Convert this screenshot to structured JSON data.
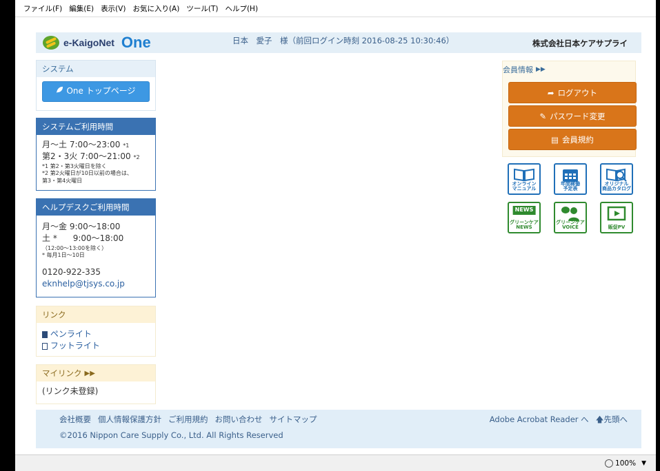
{
  "menubar": {
    "items": [
      "ファイル(F)",
      "編集(E)",
      "表示(V)",
      "お気に入り(A)",
      "ツール(T)",
      "ヘルプ(H)"
    ]
  },
  "header": {
    "logo_text": "e-KaigoNet",
    "logo_one": "One",
    "user_info": "日本　愛子　様（前回ログイン時刻 2016-08-25 10:30:46）",
    "company": "株式会社日本ケアサプライ"
  },
  "system_panel": {
    "title": "システム",
    "button_label": "One トップページ"
  },
  "usage_panel": {
    "title": "システムご利用時間",
    "line1": "月～土  7:00～23:00",
    "line1_note": "*1",
    "line2": "第2・3火 7:00～21:00",
    "line2_note": "*2",
    "note1": "*1 第2・第3火曜日を除く",
    "note2": "*2 第2火曜日が10日以前の場合は、",
    "note3": "第3・第4火曜日"
  },
  "helpdesk_panel": {
    "title": "ヘルプデスクご利用時間",
    "line1": "月～金  9:00～18:00",
    "line2": "土 *      9:00～18:00",
    "note1": "（12:00～13:00を除く）",
    "note2": "* 毎月1日～10日",
    "phone": "0120-922-335",
    "email": "eknhelp@tjsys.co.jp"
  },
  "link_panel": {
    "title": "リンク",
    "items": [
      "ペンライト",
      "フットライト"
    ]
  },
  "mylink_panel": {
    "title": "マイリンク",
    "empty": "(リンク未登録)"
  },
  "member_panel": {
    "title": "会員情報",
    "buttons": [
      "ログアウト",
      "パスワード変更",
      "会員規約"
    ]
  },
  "tiles": [
    {
      "label1": "オンライン",
      "label2": "マニュアル"
    },
    {
      "label1": "年間稼働",
      "label2": "予定表"
    },
    {
      "label1": "オリジナル",
      "label2": "商品カタログ"
    },
    {
      "label1": "グリーンケア",
      "label2": "NEWS",
      "badge": "NEWS"
    },
    {
      "label1": "グリーンケア",
      "label2": "VOICE"
    },
    {
      "label1": "販促PV",
      "label2": ""
    }
  ],
  "footer": {
    "links": [
      "会社概要",
      "個人情報保護方針",
      "ご利用規約",
      "お問い合わせ",
      "サイトマップ"
    ],
    "acrobat": "Adobe Acrobat Reader へ",
    "top_link": "先頭へ",
    "copyright": "©2016 Nippon Care Supply Co., Ltd. All Rights Reserved"
  },
  "status": {
    "zoom": "100%"
  }
}
